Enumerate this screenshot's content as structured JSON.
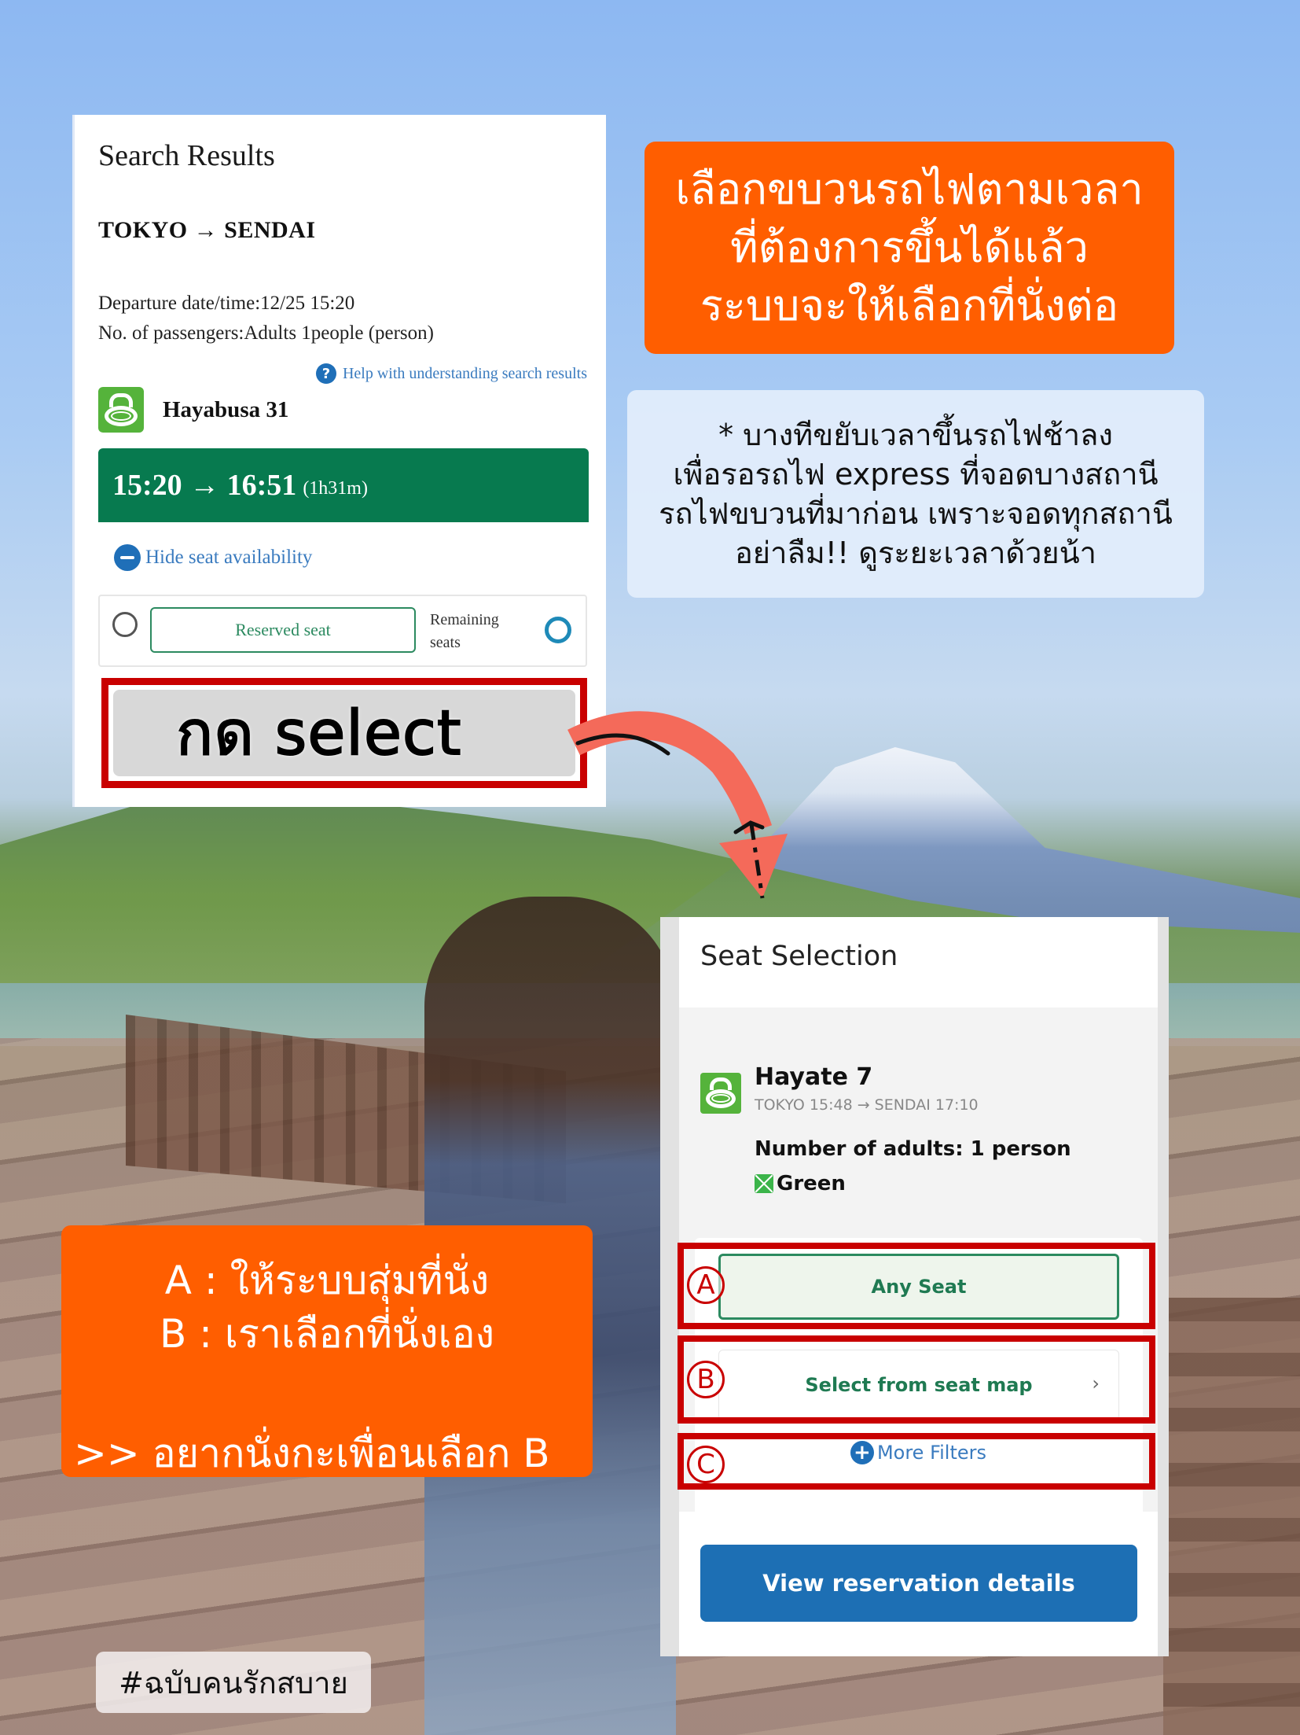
{
  "search_results": {
    "title": "Search Results",
    "route": "TOKYO  →  SENDAI",
    "departure": "Departure date/time:12/25 15:20",
    "passengers": "No. of passengers:Adults 1people (person)",
    "help_link": "Help with understanding search results",
    "help_icon": "question-circle-icon",
    "train_name": "Hayabusa 31",
    "time_range": "15:20 → 16:51",
    "duration": "(1h31m)",
    "hide_seat_label": "Hide seat availability",
    "seat_type_label": "Reserved seat",
    "remaining_label": "Remaining seats",
    "availability_symbol": "circle",
    "select_label": "กด select"
  },
  "callout_top": {
    "lines": [
      "เลือกขบวนรถไฟตามเวลา",
      "ที่ต้องการขึ้นได้แล้ว",
      "ระบบจะให้เลือกที่นั่งต่อ"
    ]
  },
  "note": {
    "lines": [
      "* บางทีขยับเวลาขึ้นรถไฟช้าลง",
      "เพื่อรอรถไฟ express ที่จอดบางสถานี",
      "รถไฟขบวนที่มาก่อน เพราะจอดทุกสถานี",
      "อย่าลืม!! ดูระยะเวลาด้วยน้า"
    ]
  },
  "seat_selection": {
    "title": "Seat Selection",
    "train_name": "Hayate 7",
    "train_route": "TOKYO 15:48 → SENDAI 17:10",
    "adults": "Number of adults: 1 person",
    "car_class": "Green",
    "options": [
      {
        "marker": "A",
        "label": "Any Seat"
      },
      {
        "marker": "B",
        "label": "Select from seat map"
      },
      {
        "marker": "C",
        "label": "More Filters"
      }
    ],
    "chevron": "›",
    "plus": "+",
    "view_button": "View reservation details"
  },
  "callout_bottom": {
    "line_a": "A : ให้ระบบสุ่มที่นั่ง",
    "line_b": "B : เราเลือกที่นั่งเอง",
    "tip": ">> อยากนั่งกะเพื่อนเลือก B"
  },
  "hashtag": "#ฉบับคนรักสบาย",
  "colors": {
    "orange": "#ff5e00",
    "highlight_red": "#c90000",
    "jr_green": "#077a4f",
    "link_blue": "#1f6fb8",
    "button_blue": "#1d6fb4",
    "arrow": "#f46a5a"
  }
}
